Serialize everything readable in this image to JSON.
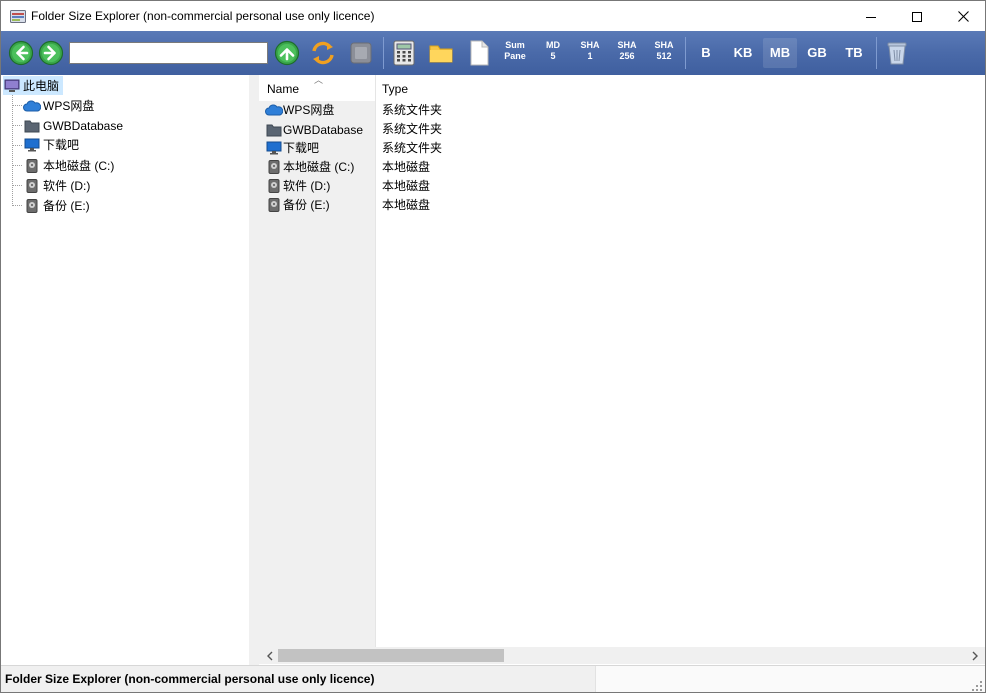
{
  "window": {
    "title": "Folder Size Explorer (non-commercial personal use only licence)"
  },
  "toolbar": {
    "path_value": "",
    "sum_pane": [
      "Sum",
      "Pane"
    ],
    "md5": [
      "MD",
      "5"
    ],
    "sha1": [
      "SHA",
      "1"
    ],
    "sha256": [
      "SHA",
      "256"
    ],
    "sha512": [
      "SHA",
      "512"
    ],
    "units": [
      "B",
      "KB",
      "MB",
      "GB",
      "TB"
    ],
    "active_unit": "MB"
  },
  "tree": {
    "root": "此电脑",
    "items": [
      {
        "label": "WPS网盘",
        "icon": "cloud-icon"
      },
      {
        "label": "GWBDatabase",
        "icon": "folder-icon"
      },
      {
        "label": "下载吧",
        "icon": "monitor-icon"
      },
      {
        "label": "本地磁盘 (C:)",
        "icon": "drive-icon"
      },
      {
        "label": "软件 (D:)",
        "icon": "drive-icon"
      },
      {
        "label": "备份 (E:)",
        "icon": "drive-icon"
      }
    ]
  },
  "list": {
    "columns": [
      "Name",
      "Type"
    ],
    "rows": [
      {
        "name": "WPS网盘",
        "type": "系统文件夹",
        "icon": "cloud-icon"
      },
      {
        "name": "GWBDatabase",
        "type": "系统文件夹",
        "icon": "folder-icon"
      },
      {
        "name": "下载吧",
        "type": "系统文件夹",
        "icon": "monitor-icon"
      },
      {
        "name": "本地磁盘 (C:)",
        "type": "本地磁盘",
        "icon": "drive-icon"
      },
      {
        "name": "软件 (D:)",
        "type": "本地磁盘",
        "icon": "drive-icon"
      },
      {
        "name": "备份 (E:)",
        "type": "本地磁盘",
        "icon": "drive-icon"
      }
    ]
  },
  "status": {
    "text": "Folder Size Explorer (non-commercial personal use only licence)"
  },
  "colors": {
    "toolbar": "#4a6aa9",
    "selection": "#cce8ff",
    "go_green": "#3aa64a"
  }
}
